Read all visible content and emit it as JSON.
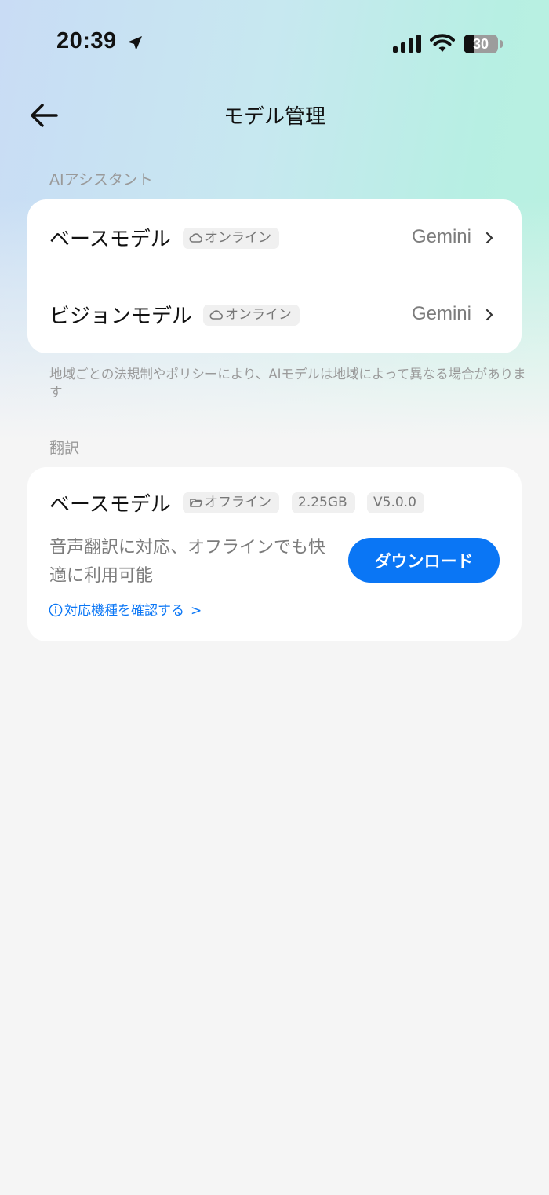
{
  "status_bar": {
    "time": "20:39",
    "battery": "30",
    "icons": [
      "location-arrow-icon",
      "cellular-signal-icon",
      "wifi-icon",
      "battery-icon"
    ]
  },
  "header": {
    "title": "モデル管理",
    "back_icon": "arrow-left-icon"
  },
  "ai_assistant": {
    "section_label": "AIアシスタント",
    "rows": [
      {
        "title": "ベースモデル",
        "badge": "オンライン",
        "badge_icon": "cloud-icon",
        "value": "Gemini"
      },
      {
        "title": "ビジョンモデル",
        "badge": "オンライン",
        "badge_icon": "cloud-icon",
        "value": "Gemini"
      }
    ],
    "note": " 地域ごとの法規制やポリシーにより、AIモデルは地域によって異なる場合があります"
  },
  "translation": {
    "section_label": "翻訳",
    "model": {
      "title": "ベースモデル",
      "badge_mode": "オフライン",
      "badge_mode_icon": "folder-icon",
      "size": "2.25GB",
      "version": "V5.0.0",
      "description": "音声翻訳に対応、オフラインでも快適に利用可能",
      "download_label": "ダウンロード",
      "check_link": "対応機種を確認する",
      "check_link_arrow": ">",
      "check_link_icon": "info-icon"
    }
  },
  "colors": {
    "accent": "#0a76f5",
    "background": "#f5f5f5",
    "card": "#ffffff",
    "muted_text": "#9a9a9a"
  }
}
